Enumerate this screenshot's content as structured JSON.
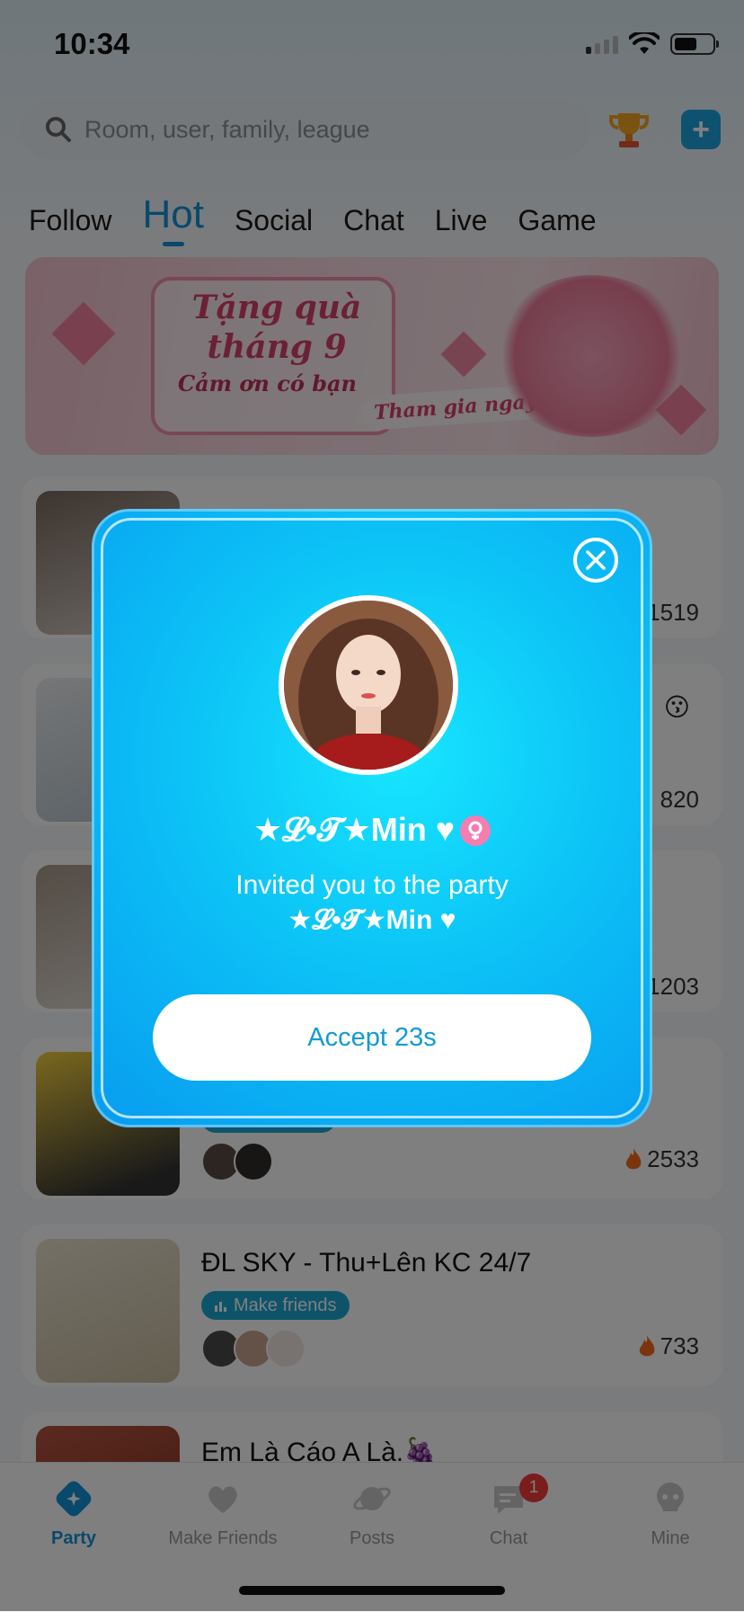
{
  "status_bar": {
    "time": "10:34"
  },
  "search": {
    "placeholder": "Room, user, family, league"
  },
  "tabs": [
    "Follow",
    "Hot",
    "Social",
    "Chat",
    "Live",
    "Game"
  ],
  "active_tab": "Hot",
  "banner": {
    "title_line1": "Tặng quà",
    "title_line2": "tháng 9",
    "subtitle": "Cảm ơn có bạn",
    "cta": "Tham gia ngay"
  },
  "rooms": [
    {
      "count": "1519"
    },
    {
      "count": "820"
    },
    {
      "count": "1203"
    },
    {
      "count": "2533"
    },
    {
      "name": "ĐL SKY - Thu+Lên KC 24/7",
      "tag": "Make friends",
      "count": "733"
    },
    {
      "name": "Em Là Cáo A Là.🍇"
    }
  ],
  "bottom_nav": [
    {
      "label": "Party",
      "icon": "party-icon"
    },
    {
      "label": "Make Friends",
      "icon": "heart-icon"
    },
    {
      "label": "Posts",
      "icon": "planet-icon"
    },
    {
      "label": "Chat",
      "icon": "chat-bubble-icon",
      "badge": "1"
    },
    {
      "label": "Mine",
      "icon": "profile-icon"
    }
  ],
  "invite_dialog": {
    "inviter_name": "★𝓛•𝓣★Min ♥",
    "message": "Invited you to the party",
    "room_name": "★𝓛•𝓣★Min ♥",
    "accept_label": "Accept 23s"
  },
  "colors": {
    "accent": "#1392d6",
    "dialog": "#0cc2f6",
    "badge": "#f23a3a"
  }
}
